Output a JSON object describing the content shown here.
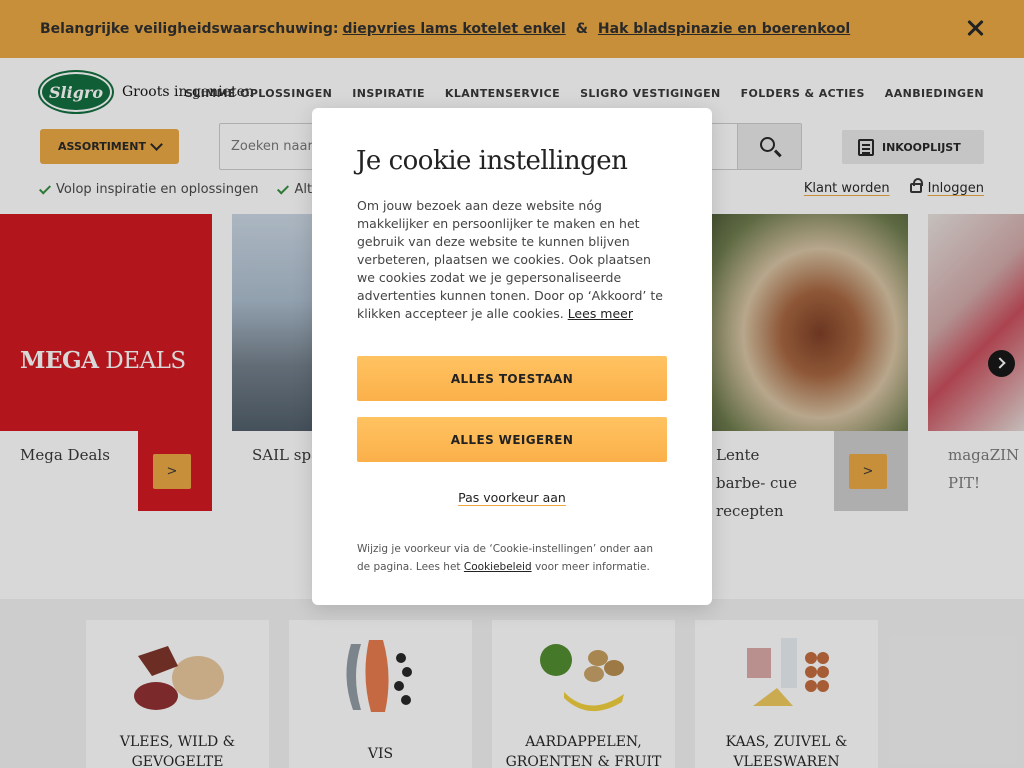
{
  "warning": {
    "prefix": "Belangrijke veiligheidswaarschuwing:",
    "link1": "diepvries lams kotelet enkel",
    "amp": "&",
    "link2": "Hak bladspinazie en boerenkool"
  },
  "header": {
    "logo_text": "Sligro",
    "tagline": "Groots in genieten",
    "nav": [
      "SLIMME OPLOSSINGEN",
      "INSPIRATIE",
      "KLANTENSERVICE",
      "SLIGRO VESTIGINGEN",
      "FOLDERS & ACTIES",
      "AANBIEDINGEN"
    ],
    "assortiment_label": "ASSORTIMENT",
    "search_placeholder": "Zoeken naar",
    "inkooplijst_label": "INKOOPLIJST",
    "usp1": "Volop inspiratie en oplossingen",
    "usp2": "Altij",
    "klant_worden": "Klant worden",
    "inloggen": "Inloggen"
  },
  "carousel": {
    "mega_title_bold": "MEGA",
    "mega_title_rest": "DEALS",
    "cards": [
      {
        "caption": "Mega Deals",
        "button": ">"
      },
      {
        "caption": "SAIL spa tie"
      },
      {
        "caption": "Lente barbe- cue recepten",
        "button": ">"
      },
      {
        "caption": "magaZIN PIT!"
      }
    ]
  },
  "categories": [
    {
      "label": "VLEES, WILD & GEVOGELTE"
    },
    {
      "label": "VIS"
    },
    {
      "label": "AARDAPPELEN, GROENTEN & FRUIT"
    },
    {
      "label": "KAAS, ZUIVEL & VLEESWAREN"
    }
  ],
  "cookie": {
    "title": "Je cookie instellingen",
    "body": "Om jouw bezoek aan deze website nóg makkelijker en persoonlijker te maken en het gebruik van deze website te kunnen blijven verbeteren, plaatsen we cookies. Ook plaatsen we cookies zodat we je gepersonaliseerde advertenties kunnen tonen. Door op ‘Akkoord’ te klikken accepteer je alle cookies.",
    "lees_meer": "Lees meer",
    "allow_all": "ALLES TOESTAAN",
    "deny_all": "ALLES WEIGEREN",
    "preferences": "Pas voorkeur aan",
    "footer_pre": "Wijzig je voorkeur via de ‘Cookie-instellingen’ onder aan de pagina. Lees het",
    "footer_link": "Cookiebeleid",
    "footer_post": "voor meer informatie."
  },
  "colors": {
    "accent": "#eca73f",
    "mega_red": "#d2121a",
    "logo_green": "#0b6b3a",
    "check_green": "#2e8b3a"
  }
}
